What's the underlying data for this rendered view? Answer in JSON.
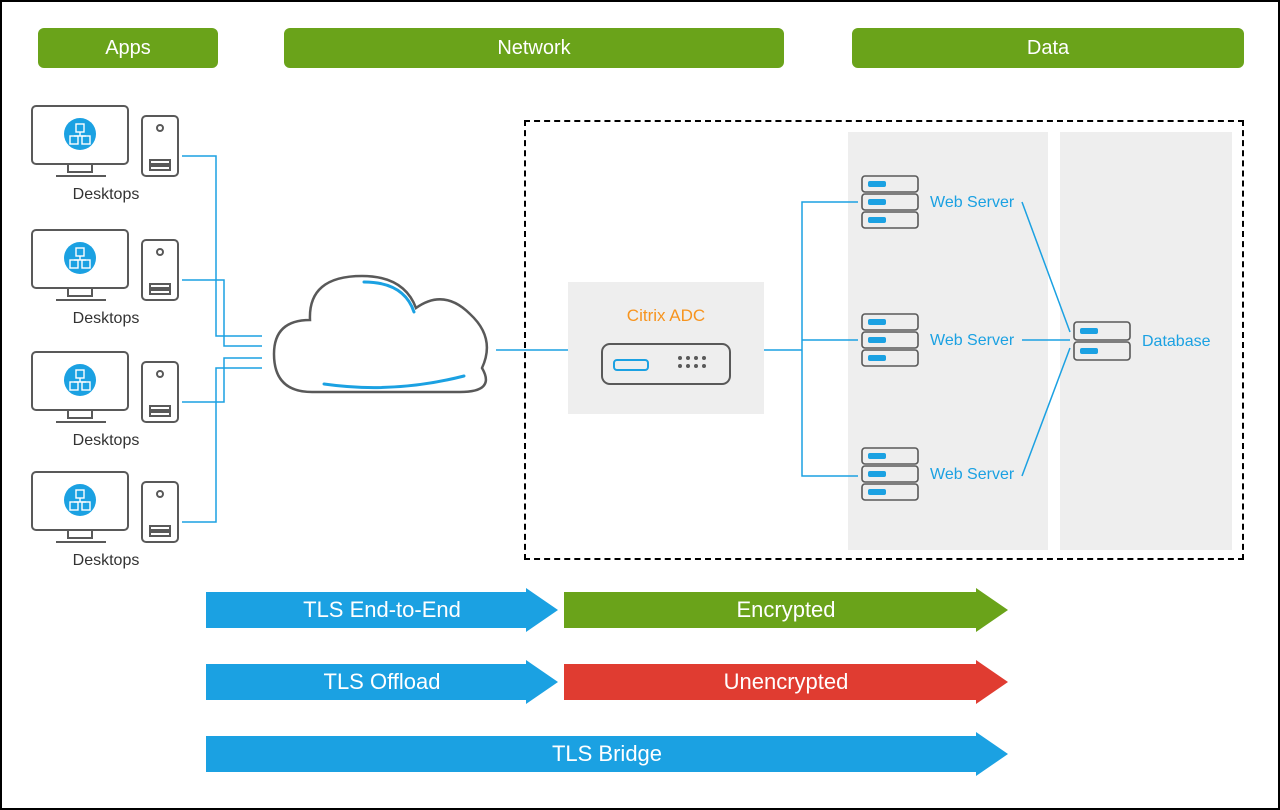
{
  "header": {
    "apps": "Apps",
    "network": "Network",
    "data": "Data"
  },
  "desktops": {
    "label": "Desktops"
  },
  "adc": {
    "label": "Citrix ADC"
  },
  "servers": {
    "web": "Web Server",
    "db": "Database"
  },
  "arrows": {
    "e2e": "TLS End-to-End",
    "encrypted": "Encrypted",
    "offload": "TLS Offload",
    "unenc": "Unencrypted",
    "bridge": "TLS Bridge"
  },
  "colors": {
    "green": "#6aa31a",
    "blue": "#1ba1e2",
    "red": "#e03c31",
    "orange": "#f7941e",
    "lgrey": "#eeeeee"
  }
}
